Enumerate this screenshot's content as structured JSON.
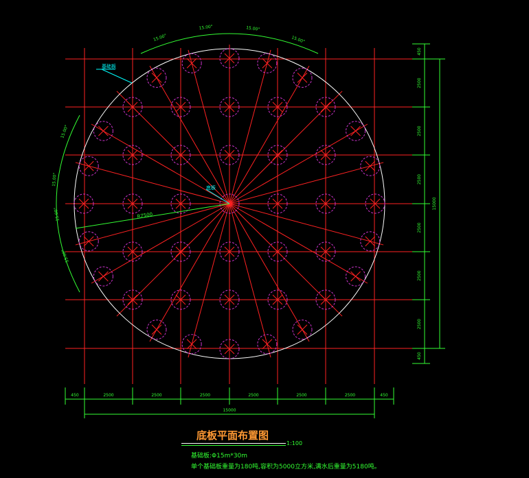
{
  "drawing": {
    "title": "底板平面布置图",
    "scale": "1:100",
    "note1": "基础板:Φ15m*30m",
    "note2": "单个基础板重量为180吨,容积为5000立方米,满水后重量为5180吨。",
    "center_label": "底板",
    "edge_label": "基础板",
    "radius_label": "R7500",
    "angle_labels": [
      "15.00°",
      "15.00°",
      "15.00°",
      "15.00°"
    ],
    "left_angle_labels": [
      "15.00°",
      "15.00°",
      "15.00°",
      "15.00°"
    ],
    "bottom_dims": [
      "450",
      "2500",
      "2500",
      "2500",
      "2500",
      "2500",
      "2500",
      "450"
    ],
    "bottom_total": "15000",
    "right_dims": [
      "450",
      "2500",
      "2500",
      "2500",
      "2500",
      "2500",
      "2500",
      "450"
    ],
    "right_total": "15000",
    "colors": {
      "grid": "#ff2222",
      "pile": "#cc33cc",
      "circle": "#ffffff",
      "dimension": "#33ff33",
      "leader": "#00ffff",
      "title": "#ff9933"
    }
  }
}
